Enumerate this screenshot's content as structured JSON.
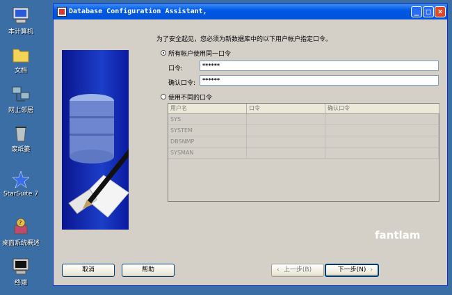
{
  "desktop": {
    "icons": [
      {
        "label": "本计算机",
        "icon": "my-computer-icon"
      },
      {
        "label": "文档",
        "icon": "folder-icon"
      },
      {
        "label": "网上邻居",
        "icon": "network-icon"
      },
      {
        "label": "废纸篓",
        "icon": "recycle-bin-icon"
      },
      {
        "label": "StarSuite 7",
        "icon": "starsuite-icon"
      },
      {
        "label": "桌面系统概述",
        "icon": "help-icon"
      },
      {
        "label": "终端",
        "icon": "terminal-icon"
      }
    ]
  },
  "window": {
    "title": "Database Configuration Assistant,",
    "controls": {
      "minimize": "_",
      "maximize": "□",
      "close": "×"
    },
    "message": "为了安全起见，您必须为新数据库中的以下用户帐户指定口令。",
    "option_same": {
      "label": "所有帐户使用同一口令",
      "selected": true
    },
    "password_label": "口令:",
    "password_value": "******",
    "confirm_label": "确认口令:",
    "confirm_value": "******",
    "option_different": {
      "label": "使用不同的口令",
      "selected": false
    },
    "table": {
      "columns": [
        "用户名",
        "口令",
        "确认口令"
      ],
      "rows": [
        [
          "SYS",
          "",
          ""
        ],
        [
          "SYSTEM",
          "",
          ""
        ],
        [
          "DBSNMP",
          "",
          ""
        ],
        [
          "SYSMAN",
          "",
          ""
        ]
      ]
    },
    "buttons": {
      "cancel": "取消",
      "help": "帮助",
      "back": "上一步(B)",
      "next": "下一步(N)"
    },
    "watermark": "fantlam"
  }
}
